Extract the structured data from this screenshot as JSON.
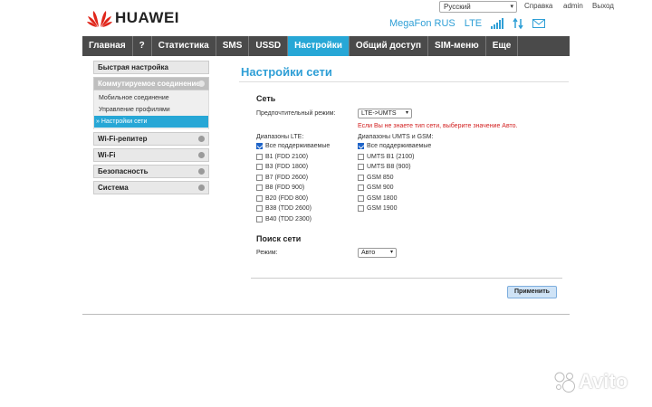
{
  "header": {
    "brand": "HUAWEI",
    "language": "Русский",
    "links": [
      "Справка",
      "admin",
      "Выход"
    ],
    "operator": "MegaFon RUS",
    "network_type": "LTE",
    "icons": [
      "signal-icon",
      "transfer-icon",
      "mail-icon"
    ]
  },
  "nav": {
    "items": [
      "Главная",
      "?",
      "Статистика",
      "SMS",
      "USSD",
      "Настройки",
      "Общий доступ",
      "SIM-меню",
      "Еще"
    ],
    "active": "Настройки"
  },
  "sidebar": {
    "quick_setup": "Быстрая настройка",
    "dialup": "Коммутируемое соединение",
    "dialup_items": [
      "Мобильное соединение",
      "Управление профилями",
      "» Настройки сети"
    ],
    "wifi_repeater": "Wi-Fi-репитер",
    "wifi": "Wi-Fi",
    "security": "Безопасность",
    "system": "Система"
  },
  "main": {
    "title": "Настройки сети",
    "network": {
      "section": "Сеть",
      "mode_label": "Предпочтительный режим:",
      "mode_value": "LTE->UMTS",
      "hint": "Если Вы не знаете тип сети, выберите значение Авто.",
      "lte_label": "Диапазоны LTE:",
      "umts_label": "Диапазоны UMTS и GSM:",
      "lte_bands": [
        {
          "label": "Все поддерживаемые",
          "checked": true
        },
        {
          "label": "B1 (FDD 2100)",
          "checked": false
        },
        {
          "label": "B3 (FDD 1800)",
          "checked": false
        },
        {
          "label": "B7 (FDD 2600)",
          "checked": false
        },
        {
          "label": "B8 (FDD 900)",
          "checked": false
        },
        {
          "label": "B20 (FDD 800)",
          "checked": false
        },
        {
          "label": "B38 (TDD 2600)",
          "checked": false
        },
        {
          "label": "B40 (TDD 2300)",
          "checked": false
        }
      ],
      "umts_bands": [
        {
          "label": "Все поддерживаемые",
          "checked": true
        },
        {
          "label": "UMTS B1 (2100)",
          "checked": false
        },
        {
          "label": "UMTS B8 (900)",
          "checked": false
        },
        {
          "label": "GSM 850",
          "checked": false
        },
        {
          "label": "GSM 900",
          "checked": false
        },
        {
          "label": "GSM 1800",
          "checked": false
        },
        {
          "label": "GSM 1900",
          "checked": false
        }
      ]
    },
    "search": {
      "section": "Поиск сети",
      "mode_label": "Режим:",
      "mode_value": "Авто"
    },
    "apply": "Применить"
  },
  "watermark": "Avito",
  "colors": {
    "accent": "#27a7d6",
    "nav_bg": "#4a4a4a",
    "warning": "#d21f1f",
    "brand_red": "#e0261b"
  }
}
